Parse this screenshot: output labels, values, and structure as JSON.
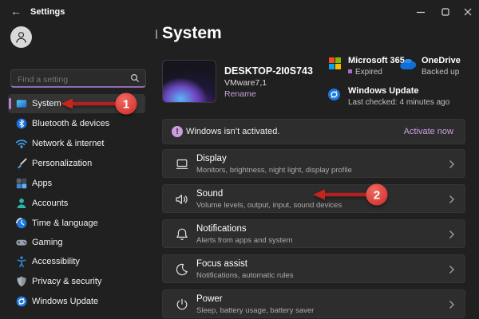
{
  "titlebar": {
    "title": "Settings"
  },
  "sidebar": {
    "search_placeholder": "Find a setting",
    "items": [
      {
        "label": "System",
        "icon": "system-icon",
        "selected": true
      },
      {
        "label": "Bluetooth & devices",
        "icon": "bluetooth-icon",
        "selected": false
      },
      {
        "label": "Network & internet",
        "icon": "network-icon",
        "selected": false
      },
      {
        "label": "Personalization",
        "icon": "personalization-icon",
        "selected": false
      },
      {
        "label": "Apps",
        "icon": "apps-icon",
        "selected": false
      },
      {
        "label": "Accounts",
        "icon": "accounts-icon",
        "selected": false
      },
      {
        "label": "Time & language",
        "icon": "time-language-icon",
        "selected": false
      },
      {
        "label": "Gaming",
        "icon": "gaming-icon",
        "selected": false
      },
      {
        "label": "Accessibility",
        "icon": "accessibility-icon",
        "selected": false
      },
      {
        "label": "Privacy & security",
        "icon": "privacy-security-icon",
        "selected": false
      },
      {
        "label": "Windows Update",
        "icon": "windows-update-icon",
        "selected": false
      }
    ]
  },
  "header": {
    "title": "System"
  },
  "device": {
    "name": "DESKTOP-2I0S743",
    "model": "VMware7,1",
    "rename_label": "Rename"
  },
  "status_cards": [
    {
      "title": "Microsoft 365",
      "detail": "Expired",
      "icon": "microsoft-365-icon"
    },
    {
      "title": "OneDrive",
      "detail": "Backed up",
      "icon": "onedrive-icon"
    },
    {
      "title": "Windows Update",
      "detail": "Last checked: 4 minutes ago",
      "icon": "windows-update-icon"
    }
  ],
  "banner": {
    "message": "Windows isn’t activated.",
    "action": "Activate now",
    "warning_glyph": "!"
  },
  "rows": [
    {
      "title": "Display",
      "subtitle": "Monitors, brightness, night light, display profile",
      "icon": "display-icon"
    },
    {
      "title": "Sound",
      "subtitle": "Volume levels, output, input, sound devices",
      "icon": "sound-icon"
    },
    {
      "title": "Notifications",
      "subtitle": "Alerts from apps and system",
      "icon": "notifications-icon"
    },
    {
      "title": "Focus assist",
      "subtitle": "Notifications, automatic rules",
      "icon": "focus-assist-icon"
    },
    {
      "title": "Power",
      "subtitle": "Sleep, battery usage, battery saver",
      "icon": "power-icon"
    }
  ],
  "annotations": {
    "step_1": "1",
    "step_2": "2"
  },
  "colors": {
    "accent_link": "#c9a0dd",
    "search_underline": "#8f6bb1",
    "selection_bar": "#b97bd6",
    "annotation_red": "#d32f2f",
    "background": "#202020",
    "card": "#2d2d2d"
  }
}
